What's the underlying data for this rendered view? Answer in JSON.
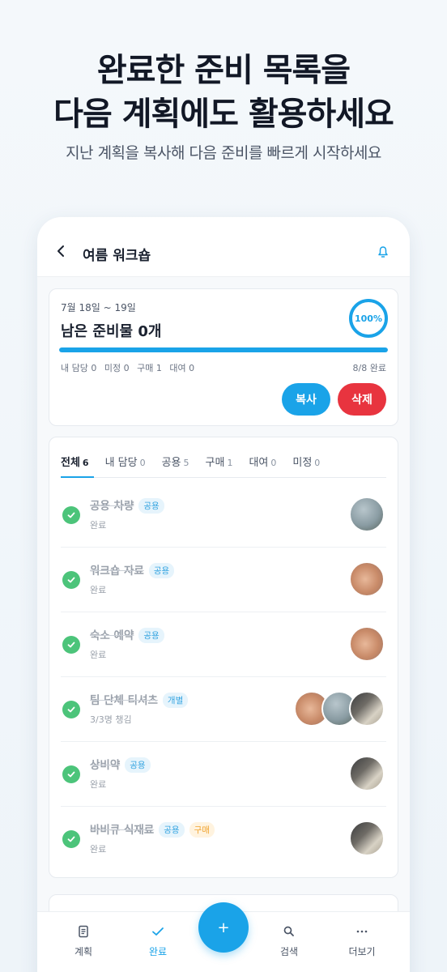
{
  "hero": {
    "title_line1": "완료한 준비 목록을",
    "title_line2": "다음 계획에도 활용하세요",
    "subtitle": "지난 계획을 복사해 다음 준비를 빠르게 시작하세요"
  },
  "appbar": {
    "title": "여름 워크숍"
  },
  "summary": {
    "date_range": "7월 18일 ~ 19일",
    "remaining_label": "남은 준비물",
    "remaining_count": "0",
    "remaining_unit": "개",
    "percent": "100%",
    "progress": 1.0,
    "stats": [
      "내 담당 0",
      "미정 0",
      "구매 1",
      "대여 0"
    ],
    "done": "8/8 완료",
    "copy_label": "복사",
    "delete_label": "삭제"
  },
  "tabs": [
    {
      "label": "전체",
      "count": "6"
    },
    {
      "label": "내 담당",
      "count": "0"
    },
    {
      "label": "공용",
      "count": "5"
    },
    {
      "label": "구매",
      "count": "1"
    },
    {
      "label": "대여",
      "count": "0"
    },
    {
      "label": "미정",
      "count": "0"
    }
  ],
  "items": [
    {
      "name": "공용 차량",
      "tags": [
        "공용"
      ],
      "status": "완료"
    },
    {
      "name": "워크숍 자료",
      "tags": [
        "공용"
      ],
      "status": "완료"
    },
    {
      "name": "숙소 예약",
      "tags": [
        "공용"
      ],
      "status": "완료"
    },
    {
      "name": "팀 단체 티셔츠",
      "tags": [
        "개별"
      ],
      "status": "3/3명 챙김"
    },
    {
      "name": "상비약",
      "tags": [
        "공용"
      ],
      "status": "완료"
    },
    {
      "name": "바비큐 식재료",
      "tags": [
        "공용",
        "구매"
      ],
      "status": "완료"
    }
  ],
  "nav": {
    "plan": "계획",
    "done": "완료",
    "add": "+",
    "search": "검색",
    "more": "더보기"
  },
  "colors": {
    "accent": "#1aa3e8",
    "danger": "#e8343f",
    "success": "#4cc47a",
    "buy": "#f0a431"
  }
}
